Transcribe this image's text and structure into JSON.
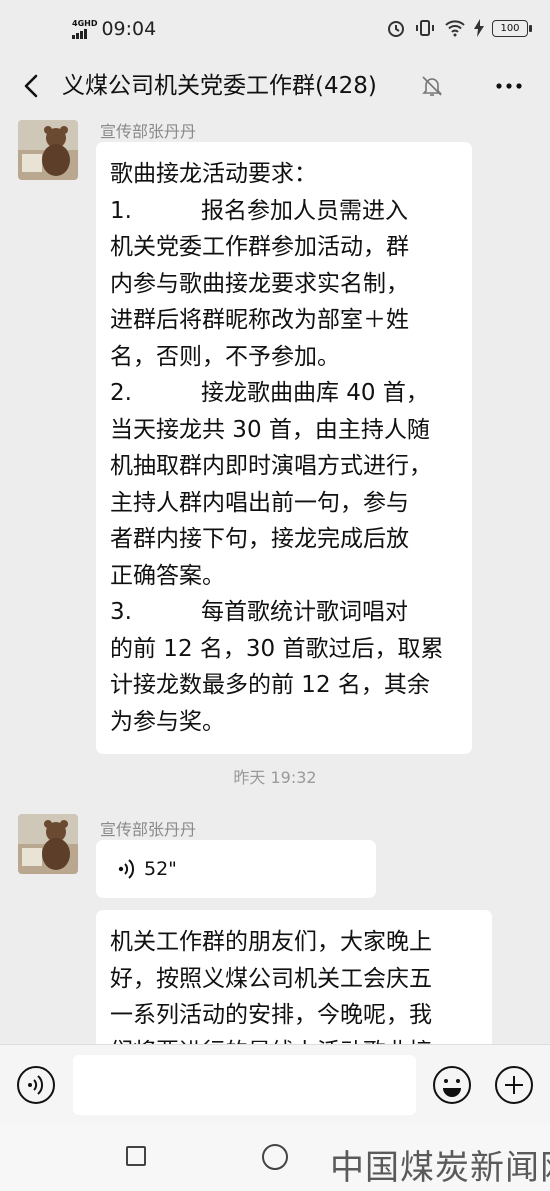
{
  "status_bar": {
    "network": "4GHD",
    "time": "09:04",
    "battery": "100",
    "icons": [
      "alarm-icon",
      "vibrate-icon",
      "wifi-icon",
      "charging-icon"
    ]
  },
  "header": {
    "title": "义煤公司机关党委工作群(428)",
    "icons": [
      "back-icon",
      "mute-bell-icon",
      "more-icon"
    ]
  },
  "messages": [
    {
      "sender": "宣传部张丹丹",
      "type": "text",
      "lines": [
        "歌曲接龙活动要求：",
        "1.　　　报名参加人员需进入",
        "机关党委工作群参加活动，群",
        "内参与歌曲接龙要求实名制，",
        "进群后将群昵称改为部室＋姓",
        "名，否则，不予参加。",
        "2.　　　接龙歌曲曲库 40 首，",
        "当天接龙共 30 首，由主持人随",
        "机抽取群内即时演唱方式进行，",
        "主持人群内唱出前一句，参与",
        "者群内接下句，接龙完成后放",
        "正确答案。",
        "3.　　　每首歌统计歌词唱对",
        "的前 12 名，30 首歌过后，取累",
        "计接龙数最多的前 12 名，其余",
        "为参与奖。"
      ]
    },
    {
      "type": "timestamp",
      "text": "昨天 19:32"
    },
    {
      "sender": "宣传部张丹丹",
      "type": "voice",
      "duration": "52\""
    },
    {
      "type": "text",
      "lines": [
        "机关工作群的朋友们，大家晚上",
        "好，按照义煤公司机关工会庆五",
        "一系列活动的安排，今晚呢，我",
        "们将要进行的是线上活动歌曲接"
      ]
    }
  ],
  "input_bar": {
    "icons": [
      "voice-input-icon",
      "emoji-icon",
      "plus-icon"
    ],
    "value": ""
  },
  "nav_bar": {
    "icons": [
      "recents-icon",
      "home-icon"
    ]
  },
  "watermark": "中国煤炭新闻网",
  "colors": {
    "background": "#ededed",
    "bubble": "#ffffff",
    "meta_text": "#8a8a8a"
  }
}
